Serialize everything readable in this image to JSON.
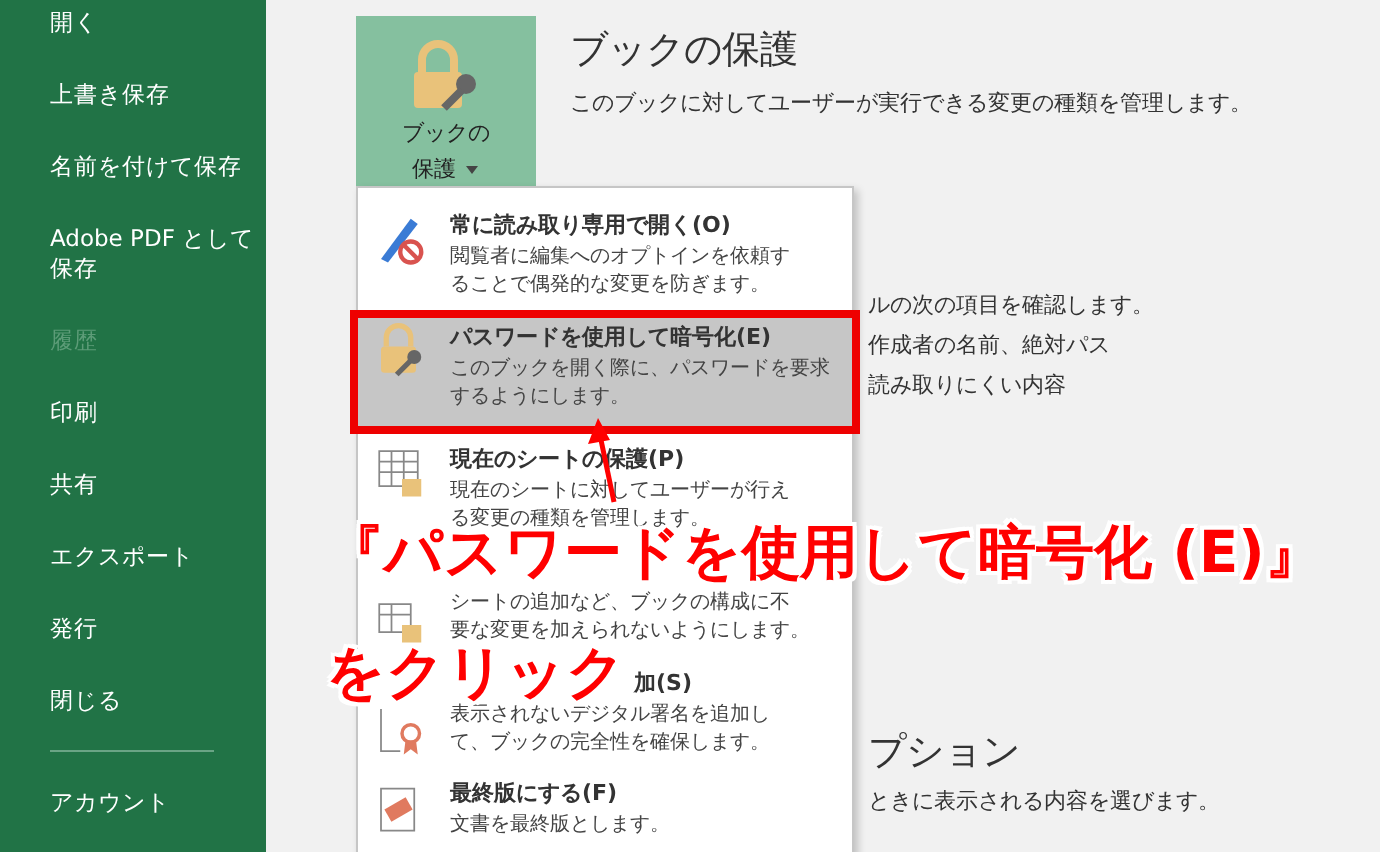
{
  "sidebar": {
    "items": [
      {
        "label": "開く",
        "disabled": false
      },
      {
        "label": "上書き保存",
        "disabled": false
      },
      {
        "label": "名前を付けて保存",
        "disabled": false
      },
      {
        "label": "Adobe PDF として保存",
        "disabled": false
      },
      {
        "label": "履歴",
        "disabled": true
      },
      {
        "label": "印刷",
        "disabled": false
      },
      {
        "label": "共有",
        "disabled": false
      },
      {
        "label": "エクスポート",
        "disabled": false
      },
      {
        "label": "発行",
        "disabled": false
      },
      {
        "label": "閉じる",
        "disabled": false
      }
    ],
    "footer_items": [
      {
        "label": "アカウント",
        "disabled": false
      }
    ]
  },
  "protect_button": {
    "label_lines": [
      "ブックの",
      "保護"
    ]
  },
  "section": {
    "title": "ブックの保護",
    "description": "このブックに対してユーザーが実行できる変更の種類を管理します。"
  },
  "inspect_lines": [
    "ルの次の項目を確認します。",
    "作成者の名前、絶対パス",
    "読み取りにくい内容"
  ],
  "options_section": {
    "title": "プション",
    "description": "ときに表示される内容を選びます。"
  },
  "menu": {
    "items": [
      {
        "kind": "readonly",
        "title": "常に読み取り専用で開く(O)",
        "description_lines": [
          "閲覧者に編集へのオプトインを依頼す",
          "ることで偶発的な変更を防ぎます。"
        ],
        "selected": false
      },
      {
        "kind": "encrypt",
        "title": "パスワードを使用して暗号化(E)",
        "description_lines": [
          "このブックを開く際に、パスワードを要求",
          "するようにします。"
        ],
        "selected": true
      },
      {
        "kind": "sheet",
        "title": "現在のシートの保護(P)",
        "description_lines": [
          "現在のシートに対してユーザーが行え",
          "る変更の種類を管理します。"
        ],
        "selected": false
      },
      {
        "kind": "structure",
        "title_covered": true,
        "description_lines": [
          "シートの追加など、ブックの構成に不",
          "要な変更を加えられないようにします。"
        ],
        "selected": false
      },
      {
        "kind": "signature",
        "title": "加(S)",
        "title_covered": true,
        "description_lines": [
          "表示されないデジタル署名を追加し",
          "て、ブックの完全性を確保します。"
        ],
        "selected": false
      },
      {
        "kind": "final",
        "title": "最終版にする(F)",
        "description_lines": [
          "文書を最終版とします。"
        ],
        "selected": false
      }
    ]
  },
  "annotation": {
    "lines": [
      "『パスワードを使用して暗号化 (E)』",
      "をクリック"
    ]
  }
}
